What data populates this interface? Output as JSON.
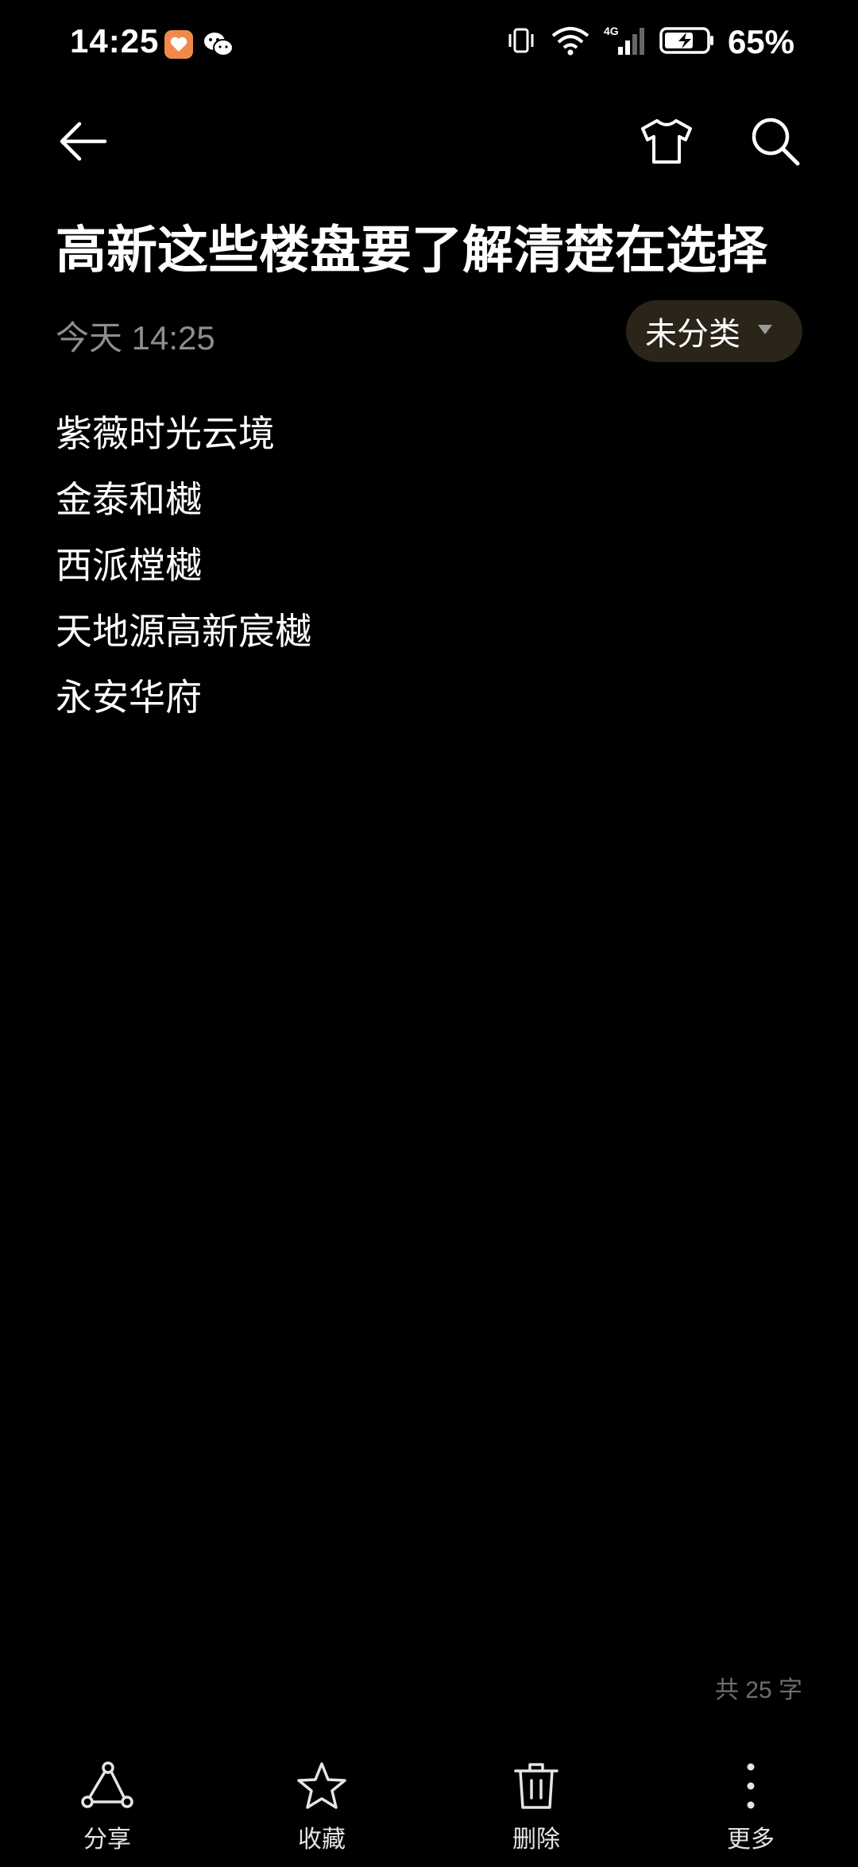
{
  "status_bar": {
    "time": "14:25",
    "battery": "65%",
    "network": "4G"
  },
  "toolbar": {
    "back_icon": "back-arrow-icon",
    "theme_icon": "tshirt-icon",
    "search_icon": "search-icon"
  },
  "note": {
    "title": "高新这些楼盘要了解清楚在选择",
    "date": "今天 14:25",
    "category": "未分类",
    "lines": [
      "紫薇时光云境",
      "金泰和樾",
      "西派樘樾",
      "天地源高新宸樾",
      "永安华府"
    ],
    "word_count": "共 25 字"
  },
  "bottom_bar": {
    "share": "分享",
    "favorite": "收藏",
    "delete": "删除",
    "more": "更多"
  },
  "colors": {
    "background": "#000000",
    "text": "#ffffff",
    "muted": "#8e8e8e",
    "pill": "#2a2419"
  }
}
